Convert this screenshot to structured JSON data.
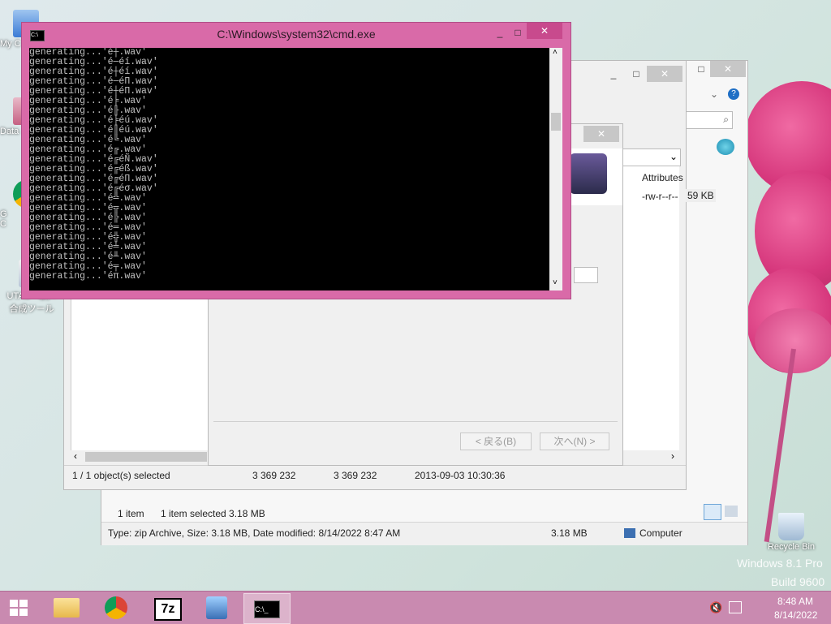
{
  "desktop": {
    "icons": [
      {
        "label": "My C"
      },
      {
        "label": "Data"
      },
      {
        "label": "G\nC"
      },
      {
        "label": "UTAU - 歌声\n合成ツール"
      },
      {
        "label": "Recycle Bin"
      }
    ],
    "watermark_line1": "Windows 8.1 Pro",
    "watermark_line2": "Build 9600"
  },
  "explorer": {
    "status_items": "1 item",
    "status_selected": "1 item selected  3.18 MB",
    "details_bar": "Type: zip Archive, Size: 3.18 MB, Date modified: 8/14/2022 8:47 AM",
    "details_size": "3.18 MB",
    "details_location": "Computer"
  },
  "sevenzip": {
    "column_attributes": "Attributes",
    "cell_attributes": "-rw-r--r--",
    "cell_size_partial": "59 KB",
    "status_selected": "1 / 1 object(s) selected",
    "status_size": "3 369 232",
    "status_packed": "3 369 232",
    "status_modified": "2013-09-03 10:30:36"
  },
  "wizard": {
    "back_button": "< 戻る(B)",
    "next_button": "次へ(N) >"
  },
  "cmd": {
    "title": "C:\\Windows\\system32\\cmd.exe",
    "lines": [
      "generating...'é┼.wav'",
      "generating...'é─éí.wav'",
      "generating...'é┼éí.wav'",
      "generating...'é─éΠ.wav'",
      "generating...'é┼éΠ.wav'",
      "generating...'é╞.wav'",
      "generating...'é╟.wav'",
      "generating...'é╞éú.wav'",
      "generating...'é║éú.wav'",
      "generating...'é╚.wav'",
      "generating...'é╔.wav'",
      "generating...'é╔éÑ.wav'",
      "generating...'é╔éß.wav'",
      "generating...'é╔éΠ.wav'",
      "generating...'é╔éσ.wav'",
      "generating...'é╩.wav'",
      "generating...'é╦.wav'",
      "generating...'é╠.wav'",
      "generating...'é═.wav'",
      "generating...'é╬.wav'",
      "generating...'é╧.wav'",
      "generating...'é╨.wav'",
      "generating...'é╤.wav'",
      "generating...'éπ.wav'"
    ]
  },
  "taskbar": {
    "time": "8:48 AM",
    "date": "8/14/2022",
    "apps": [
      {
        "name": "file-explorer"
      },
      {
        "name": "chrome"
      },
      {
        "name": "7-zip"
      },
      {
        "name": "utau-setup"
      },
      {
        "name": "cmd"
      }
    ]
  }
}
